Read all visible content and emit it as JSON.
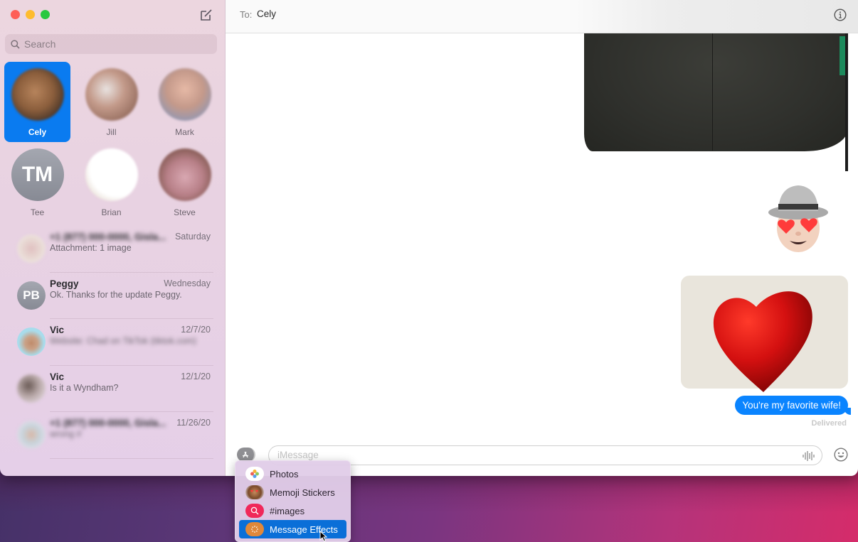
{
  "window": {
    "traffic_lights": [
      "close",
      "minimize",
      "maximize"
    ],
    "compose_icon": "compose-icon"
  },
  "sidebar": {
    "search": {
      "placeholder": "Search",
      "value": ""
    },
    "pinned": [
      {
        "name": "Cely",
        "selected": true,
        "avatar": "photo"
      },
      {
        "name": "Jill",
        "selected": false,
        "avatar": "photo"
      },
      {
        "name": "Mark",
        "selected": false,
        "avatar": "photo"
      },
      {
        "name": "Tee",
        "selected": false,
        "avatar": "initials",
        "initials": "TM"
      },
      {
        "name": "Brian",
        "selected": false,
        "avatar": "photo"
      },
      {
        "name": "Steve",
        "selected": false,
        "avatar": "photo"
      }
    ],
    "conversations": [
      {
        "name": "+1 (877) 000-0000, Gisla...",
        "name_blurred": true,
        "date": "Saturday",
        "preview": "Attachment: 1 image",
        "preview_blurred": false
      },
      {
        "name": "Peggy",
        "name_blurred": false,
        "date": "Wednesday",
        "preview": "Ok. Thanks for the update Peggy.",
        "preview_blurred": false,
        "initials": "PB"
      },
      {
        "name": "Vic",
        "name_blurred": false,
        "date": "12/7/20",
        "preview": "Website: Chad on TikTok (tiktok.com)",
        "preview_blurred": true
      },
      {
        "name": "Vic",
        "name_blurred": false,
        "date": "12/1/20",
        "preview": "Is it a Wyndham?",
        "preview_blurred": false
      },
      {
        "name": "+1 (877) 000-0000, Gisla...",
        "name_blurred": true,
        "date": "11/26/20",
        "preview": "wrong #",
        "preview_blurred": true
      }
    ]
  },
  "header": {
    "to_label": "To:",
    "recipient": "Cely",
    "info_icon": "info-icon"
  },
  "messages": {
    "items": [
      {
        "type": "image",
        "description": "dark fabric photo",
        "sender": "me"
      },
      {
        "type": "sticker",
        "description": "memoji with heart eyes and hat",
        "sender": "me"
      },
      {
        "type": "image",
        "description": "red heart on paper",
        "sender": "me"
      },
      {
        "type": "text",
        "text": "You're my favorite wife!",
        "sender": "me"
      }
    ],
    "status": "Delivered"
  },
  "composer": {
    "placeholder": "iMessage",
    "value": ""
  },
  "apps_menu": {
    "items": [
      {
        "label": "Photos",
        "icon": "photos-icon",
        "active": false
      },
      {
        "label": "Memoji Stickers",
        "icon": "memoji-icon",
        "active": false
      },
      {
        "label": "#images",
        "icon": "images-search-icon",
        "active": false
      },
      {
        "label": "Message Effects",
        "icon": "message-effects-icon",
        "active": true
      }
    ]
  },
  "colors": {
    "accent": "#0a84ff",
    "selection": "#0a7bf0",
    "menu_highlight": "#0a6fd8"
  }
}
